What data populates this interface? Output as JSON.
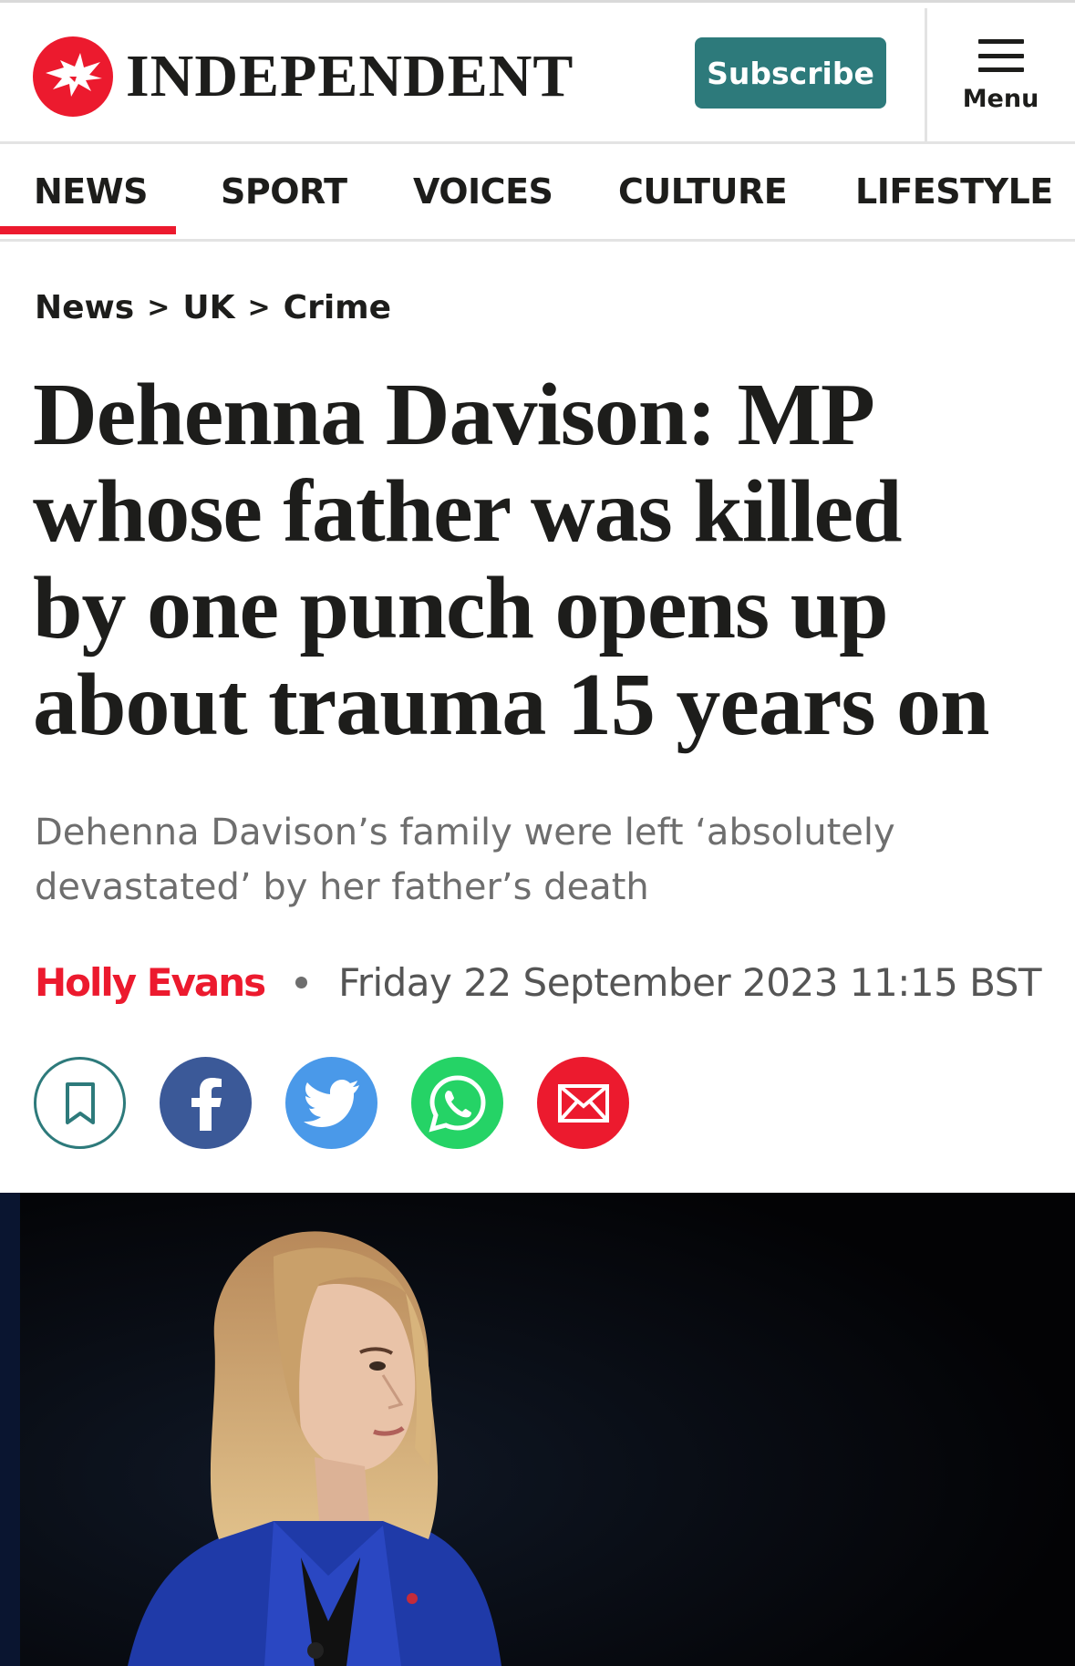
{
  "brand": {
    "name": "INDEPENDENT",
    "accent": "#ec1a2e",
    "teal": "#2d7a7b"
  },
  "header": {
    "subscribe_label": "Subscribe",
    "menu_label": "Menu"
  },
  "nav": {
    "items": [
      {
        "label": "NEWS",
        "active": true
      },
      {
        "label": "SPORT",
        "active": false
      },
      {
        "label": "VOICES",
        "active": false
      },
      {
        "label": "CULTURE",
        "active": false
      },
      {
        "label": "LIFESTYLE",
        "active": false
      }
    ]
  },
  "breadcrumb": {
    "items": [
      "News",
      "UK",
      "Crime"
    ],
    "separator": ">"
  },
  "article": {
    "headline_lines": [
      "Dehenna Davison: MP",
      "whose father was killed",
      "by one punch opens up",
      "about trauma 15 years on"
    ],
    "standfirst": "Dehenna Davison’s family were left ‘absolutely devastated’ by her father’s death",
    "author": "Holly Evans",
    "date": "Friday 22 September 2023 11:15 BST"
  },
  "share": {
    "buttons": [
      "bookmark-icon",
      "facebook-icon",
      "twitter-icon",
      "whatsapp-icon",
      "email-icon"
    ]
  }
}
